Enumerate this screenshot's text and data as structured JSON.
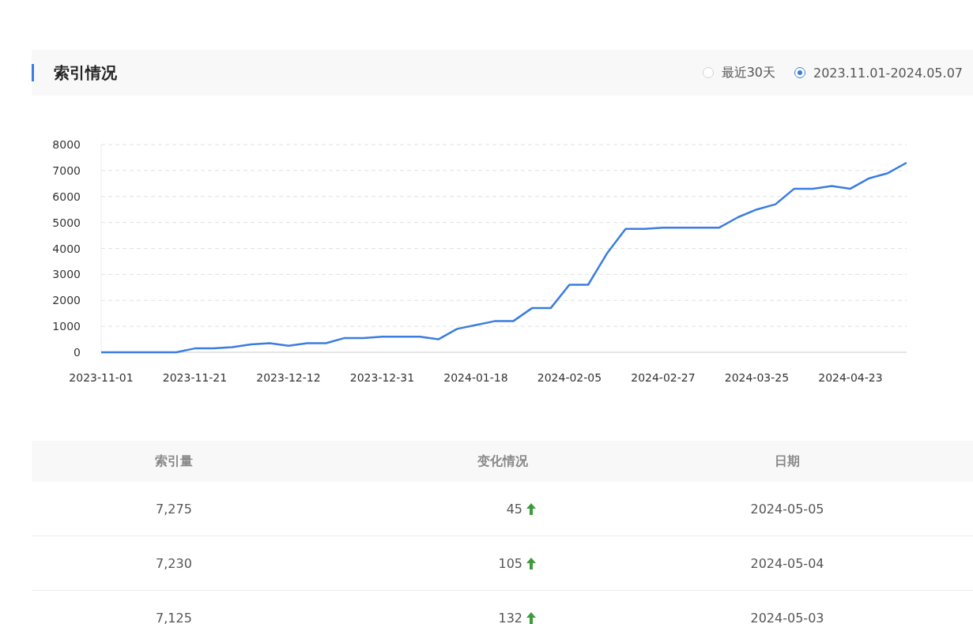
{
  "section": {
    "title": "索引情况",
    "range_options": [
      {
        "label": "最近30天",
        "selected": false
      },
      {
        "label": "2023.11.01-2024.05.07",
        "selected": true
      }
    ],
    "chart_data": {
      "type": "line",
      "grid": true,
      "ylim": [
        0,
        8000
      ],
      "yticks": [
        0,
        1000,
        2000,
        3000,
        4000,
        5000,
        6000,
        7000,
        8000
      ],
      "categories": [
        "2023-11-01",
        null,
        null,
        null,
        null,
        "2023-11-21",
        null,
        null,
        null,
        null,
        "2023-12-12",
        null,
        null,
        null,
        null,
        "2023-12-31",
        null,
        null,
        null,
        null,
        "2024-01-18",
        null,
        null,
        null,
        null,
        "2024-02-05",
        null,
        null,
        null,
        null,
        "2024-02-27",
        null,
        null,
        null,
        null,
        "2024-03-25",
        null,
        null,
        null,
        null,
        "2024-04-23",
        null,
        null,
        null
      ],
      "series": [
        {
          "color": "#3a7de0",
          "values": [
            0,
            0,
            0,
            0,
            0,
            150,
            150,
            200,
            300,
            350,
            250,
            350,
            350,
            550,
            550,
            600,
            600,
            600,
            500,
            900,
            1050,
            1200,
            1200,
            1700,
            1700,
            2600,
            2600,
            3800,
            4750,
            4750,
            4800,
            4800,
            4800,
            4800,
            5200,
            5500,
            5700,
            6300,
            6300,
            6400,
            6300,
            6700,
            6900,
            7300
          ]
        }
      ]
    }
  },
  "table": {
    "columns": [
      "索引量",
      "变化情况",
      "日期"
    ],
    "rows": [
      {
        "count": "7,275",
        "change": "45",
        "up": true,
        "date": "2024-05-05"
      },
      {
        "count": "7,230",
        "change": "105",
        "up": true,
        "date": "2024-05-04"
      },
      {
        "count": "7,125",
        "change": "132",
        "up": true,
        "date": "2024-05-03"
      }
    ]
  }
}
